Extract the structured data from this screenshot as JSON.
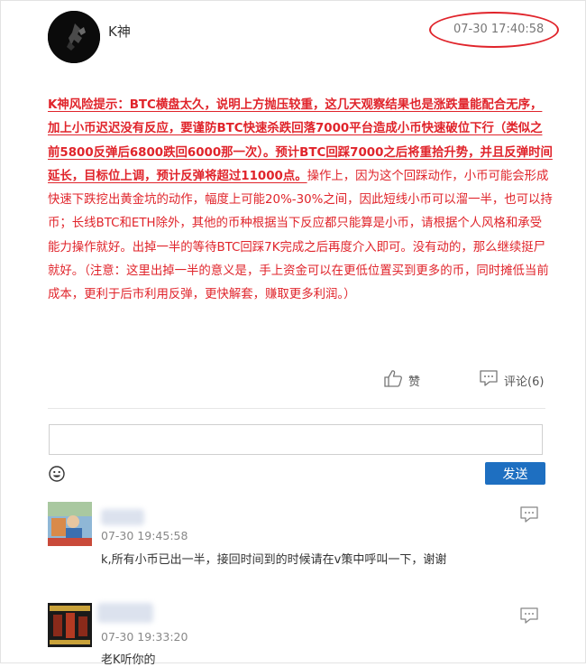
{
  "post": {
    "author": "K神",
    "timestamp": "07-30 17:40:58",
    "body_strong": "K神风险提示：BTC横盘太久，说明上方抛压较重，这几天观察结果也是涨跌量能配合无序，加上小币迟迟没有反应，要谨防BTC快速杀跌回落7000平台造成小币快速破位下行（类似之前5800反弹后6800跌回6000那一次）。预计BTC回踩7000之后将重拾升势，并且反弹时间延长，目标位上调，预计反弹将超过11000点。",
    "body_normal": "操作上，因为这个回踩动作，小币可能会形成快速下跌挖出黄金坑的动作，幅度上可能20%-30%之间，因此短线小币可以溜一半，也可以持币；长线BTC和ETH除外，其他的币种根据当下反应都只能算是小币，请根据个人风格和承受能力操作就好。出掉一半的等待BTC回踩7K完成之后再度介入即可。没有动的，那么继续挺尸就好。（注意：这里出掉一半的意义是，手上资金可以在更低位置买到更多的币，同时摊低当前成本，更利于后市利用反弹，更快解套，赚取更多利润。）"
  },
  "actions": {
    "like_label": "赞",
    "comment_label": "评论(6)"
  },
  "composer": {
    "placeholder": "",
    "send_label": "发送"
  },
  "comments": [
    {
      "time": "07-30 19:45:58",
      "text": "k,所有小币已出一半，接回时间到的时候请在v策中呼叫一下，谢谢"
    },
    {
      "time": "07-30 19:33:20",
      "text": "老K听你的"
    }
  ],
  "colors": {
    "alert_red": "#e0242b",
    "send_blue": "#1e6fc1",
    "muted_gray": "#888888"
  }
}
